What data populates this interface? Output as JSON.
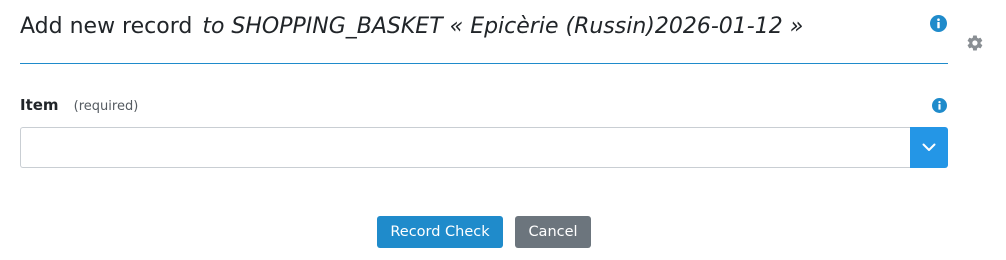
{
  "header": {
    "title": "Add new record",
    "subtitle": "to SHOPPING_BASKET « Epicèrie (Russin)2026-01-12 »",
    "info_icon": "info-icon",
    "settings_icon": "gear-icon"
  },
  "form": {
    "item": {
      "label": "Item",
      "required_note": "(required)",
      "value": "",
      "placeholder": "",
      "dropdown_icon": "chevron-down-icon",
      "info_icon": "info-icon"
    }
  },
  "actions": {
    "record_check_label": "Record Check",
    "cancel_label": "Cancel"
  },
  "colors": {
    "accent": "#1f8bcb",
    "dropdown_button": "#2496e6",
    "secondary_button": "#6c757d",
    "divider": "#1f8bcb"
  }
}
